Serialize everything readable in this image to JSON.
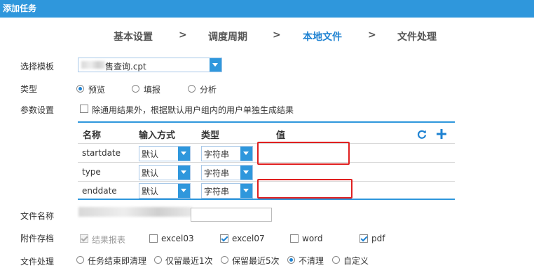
{
  "window": {
    "title": "添加任务"
  },
  "steps": {
    "items": [
      "基本设置",
      "调度周期",
      "本地文件",
      "文件处理"
    ],
    "separator": ">",
    "active": "本地文件"
  },
  "template": {
    "label": "选择模板",
    "value": "售查询.cpt"
  },
  "type": {
    "label": "类型",
    "options": [
      "预览",
      "填报",
      "分析"
    ],
    "selected": "预览"
  },
  "params": {
    "label": "参数设置",
    "checkbox_label": "除通用结果外，根据默认用户组内的用户单独生成结果",
    "checked": false,
    "headers": [
      "名称",
      "输入方式",
      "类型",
      "值"
    ],
    "rows": [
      {
        "name": "startdate",
        "input": "默认",
        "type": "字符串",
        "value": ""
      },
      {
        "name": "type",
        "input": "默认",
        "type": "字符串",
        "value": ""
      },
      {
        "name": "enddate",
        "input": "默认",
        "type": "字符串",
        "value": ""
      }
    ],
    "highlight_color": "#e02020"
  },
  "filename": {
    "label": "文件名称",
    "value": ""
  },
  "attachments": {
    "label": "附件存档",
    "options": [
      {
        "label": "结果报表",
        "checked": true,
        "disabled": true
      },
      {
        "label": "excel03",
        "checked": false
      },
      {
        "label": "excel07",
        "checked": true
      },
      {
        "label": "word",
        "checked": false
      },
      {
        "label": "pdf",
        "checked": true
      }
    ]
  },
  "processing": {
    "label": "文件处理",
    "options": [
      "任务结束即清理",
      "仅留最近1次",
      "保留最近5次",
      "不清理",
      "自定义"
    ],
    "selected": "不清理"
  },
  "colors": {
    "accent": "#2f97dc",
    "active_step": "#1e82d2"
  }
}
